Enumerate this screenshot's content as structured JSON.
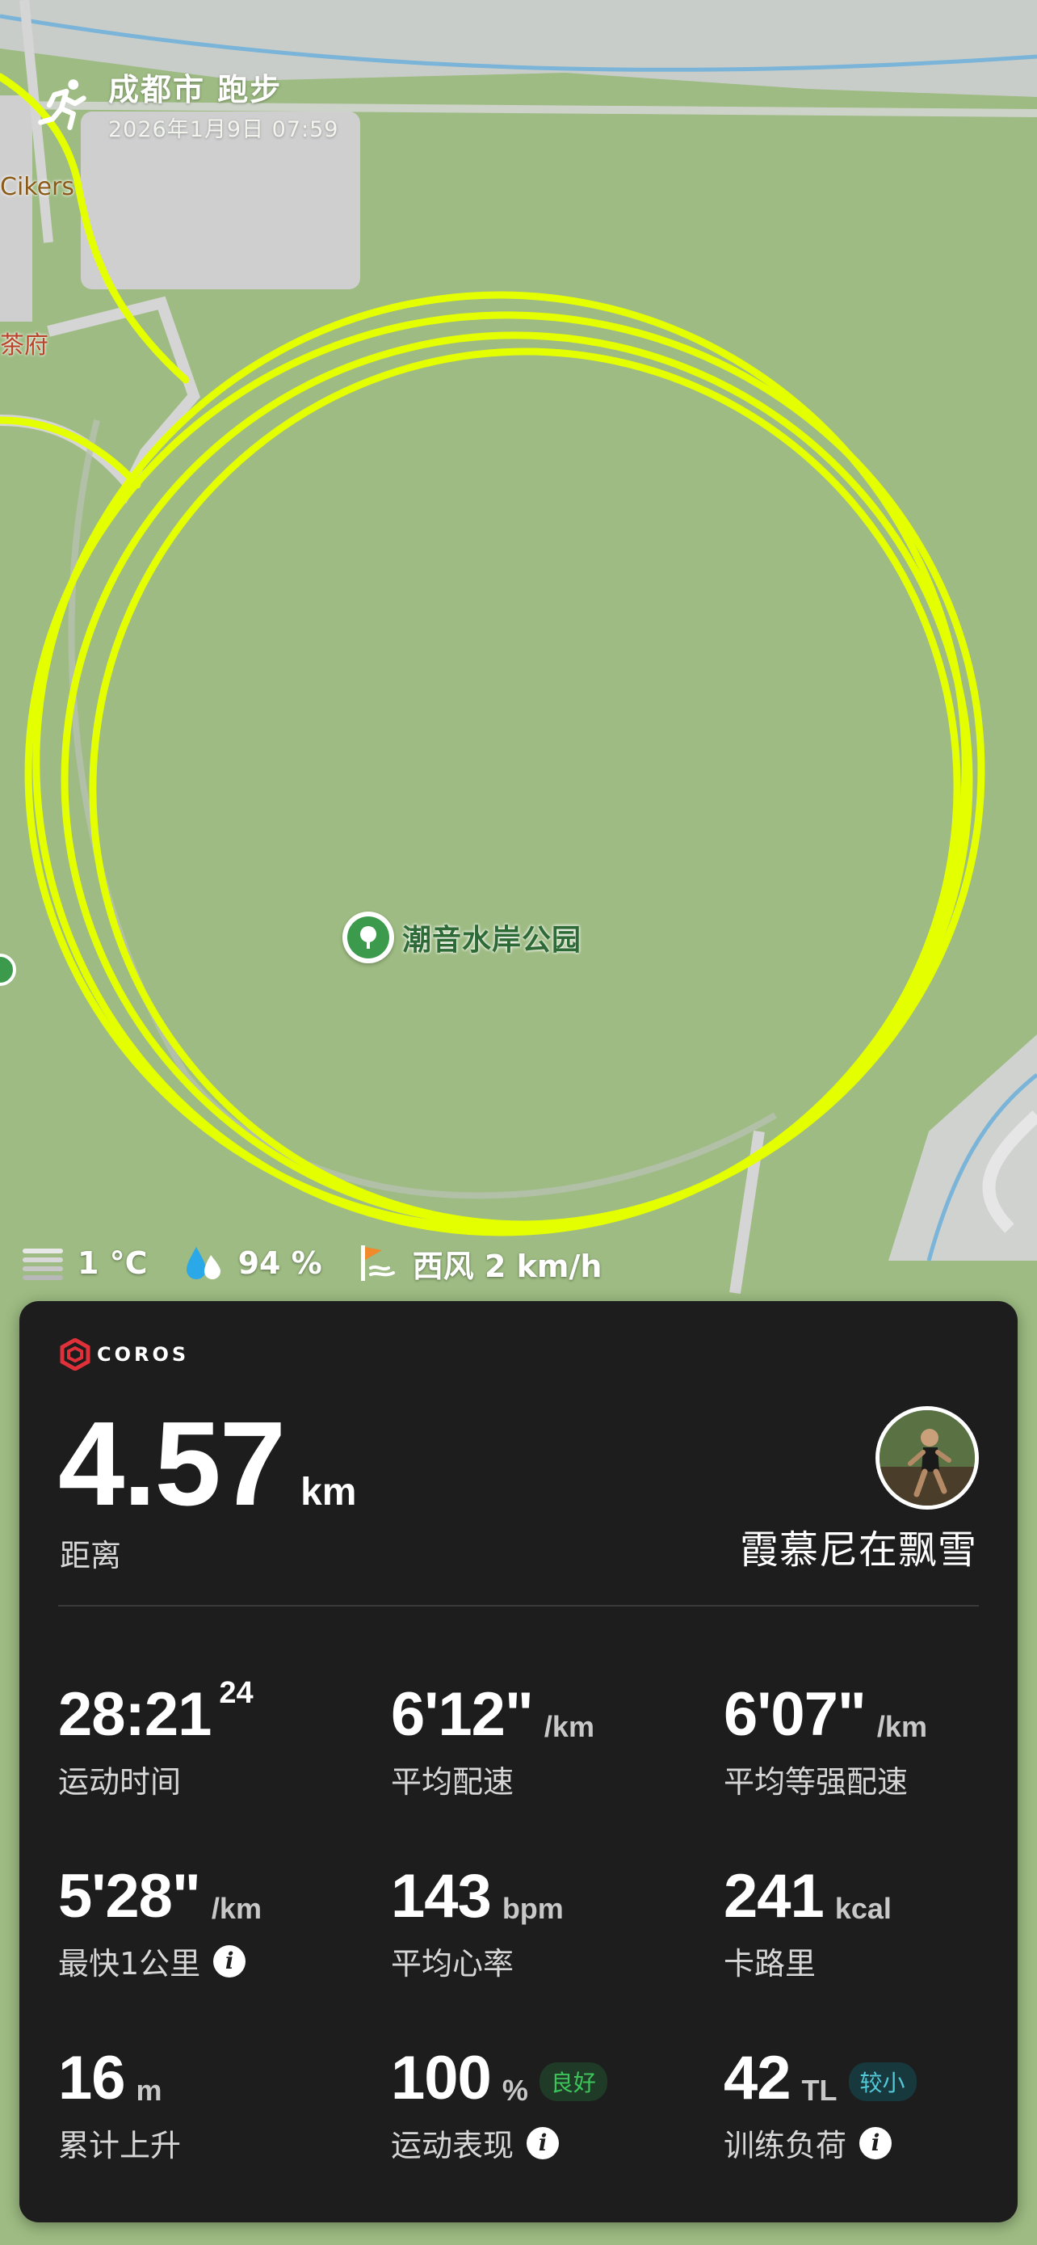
{
  "header": {
    "title": "成都市 跑步",
    "datetime": "2026年1月9日 07:59"
  },
  "map": {
    "labels": {
      "cikers": "Cikers",
      "teahouse": "茶府"
    },
    "poi": "潮音水岸公园",
    "route_color": "#e4ff00"
  },
  "weather": {
    "temperature": "1 °C",
    "humidity": "94 %",
    "wind": "西风 2 km/h"
  },
  "card": {
    "brand": "COROS",
    "distance": {
      "value": "4.57",
      "unit": "km",
      "label": "距离"
    },
    "username": "霞慕尼在飘雪",
    "stats": [
      {
        "value": "28:21",
        "sup": "24",
        "unit": "",
        "label": "运动时间"
      },
      {
        "value": "6'12\"",
        "unit": "/km",
        "label": "平均配速"
      },
      {
        "value": "6'07\"",
        "unit": "/km",
        "label": "平均等强配速"
      },
      {
        "value": "5'28\"",
        "unit": "/km",
        "label": "最快1公里"
      },
      {
        "value": "143",
        "unit": "bpm",
        "label": "平均心率"
      },
      {
        "value": "241",
        "unit": "kcal",
        "label": "卡路里"
      },
      {
        "value": "16",
        "unit": "m",
        "label": "累计上升"
      },
      {
        "value": "100",
        "unit": "%",
        "badge": "良好",
        "label": "运动表现"
      },
      {
        "value": "42",
        "unit": "TL",
        "badge": "较小",
        "label": "训练负荷"
      }
    ]
  },
  "colors": {
    "card_bg": "#1d1d1d",
    "badge_good": "#3dc45a",
    "badge_low": "#53c8d8",
    "brand_red": "#e0303a"
  }
}
